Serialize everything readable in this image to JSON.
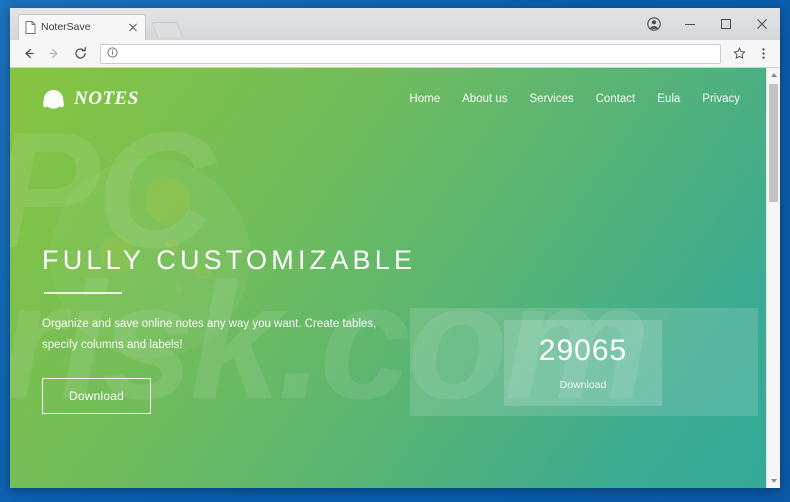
{
  "browser": {
    "tab": {
      "title": "NoterSave",
      "favicon": "page-icon",
      "close": "×"
    },
    "new_tab_label": "+",
    "window_controls": {
      "profile": "profile-icon",
      "minimize": "–",
      "maximize": "□",
      "close": "✕"
    },
    "toolbar": {
      "back": "←",
      "forward": "→",
      "reload": "⟳",
      "site_info": "info-icon",
      "url": "",
      "url_placeholder": "",
      "bookmark": "☆",
      "menu": "⋮"
    }
  },
  "site": {
    "brand": {
      "name": "NOTES",
      "mark": "headphones-icon"
    },
    "nav": [
      {
        "label": "Home"
      },
      {
        "label": "About us"
      },
      {
        "label": "Services"
      },
      {
        "label": "Contact"
      },
      {
        "label": "Eula"
      },
      {
        "label": "Privacy"
      }
    ],
    "hero": {
      "title": "FULLY CUSTOMIZABLE",
      "subtitle": "Organize and save online notes any way you want. Create tables, specify columns and labels!",
      "cta_label": "Download"
    },
    "counter": {
      "value": "29065",
      "label": "Download"
    },
    "watermark": {
      "line1": "PC",
      "line2": "risk.com"
    }
  },
  "colors": {
    "gradient_start": "#86c440",
    "gradient_end": "#34a998",
    "desktop": "#0a5fae",
    "text_on_hero": "#ffffff"
  }
}
